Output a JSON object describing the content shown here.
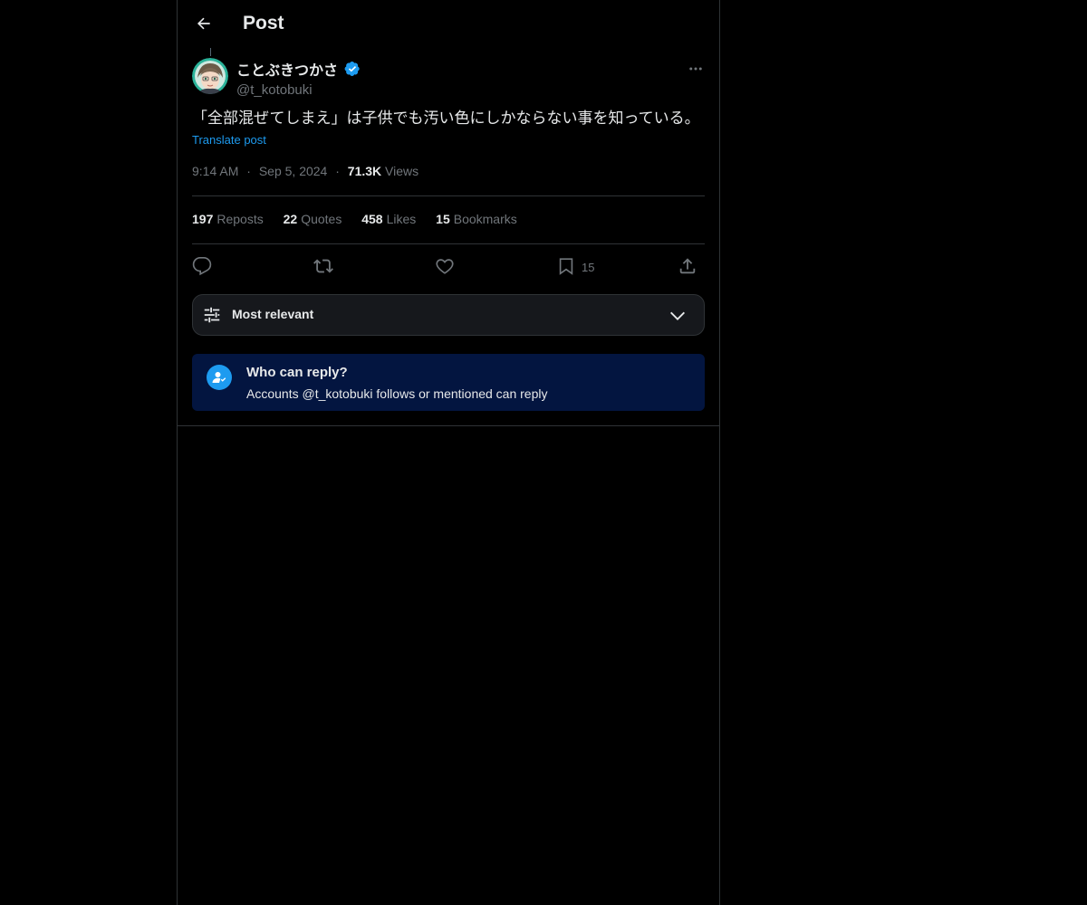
{
  "header": {
    "title": "Post"
  },
  "author": {
    "display_name": "ことぶきつかさ",
    "handle": "@t_kotobuki",
    "verified": true
  },
  "post": {
    "text": "「全部混ぜてしまえ」は子供でも汚い色にしかならない事を知っている。",
    "translate_label": "Translate post",
    "time": "9:14 AM",
    "date": "Sep 5, 2024",
    "views_count": "71.3K",
    "views_label": "Views",
    "separator": "·"
  },
  "stats": [
    {
      "num": "197",
      "label": "Reposts"
    },
    {
      "num": "22",
      "label": "Quotes"
    },
    {
      "num": "458",
      "label": "Likes"
    },
    {
      "num": "15",
      "label": "Bookmarks"
    }
  ],
  "actions": {
    "reply_icon": "reply-icon",
    "repost_icon": "repost-icon",
    "like_icon": "heart-icon",
    "bookmark_icon": "bookmark-icon",
    "bookmark_count": "15",
    "share_icon": "share-icon"
  },
  "sort": {
    "label": "Most relevant"
  },
  "reply_settings": {
    "title": "Who can reply?",
    "description": "Accounts @t_kotobuki follows or mentioned can reply"
  },
  "colors": {
    "background": "#000000",
    "text_primary": "#e7e9ea",
    "text_secondary": "#71767b",
    "accent": "#1d9bf0",
    "border": "#2f3336",
    "reply_box_bg": "#031540"
  }
}
